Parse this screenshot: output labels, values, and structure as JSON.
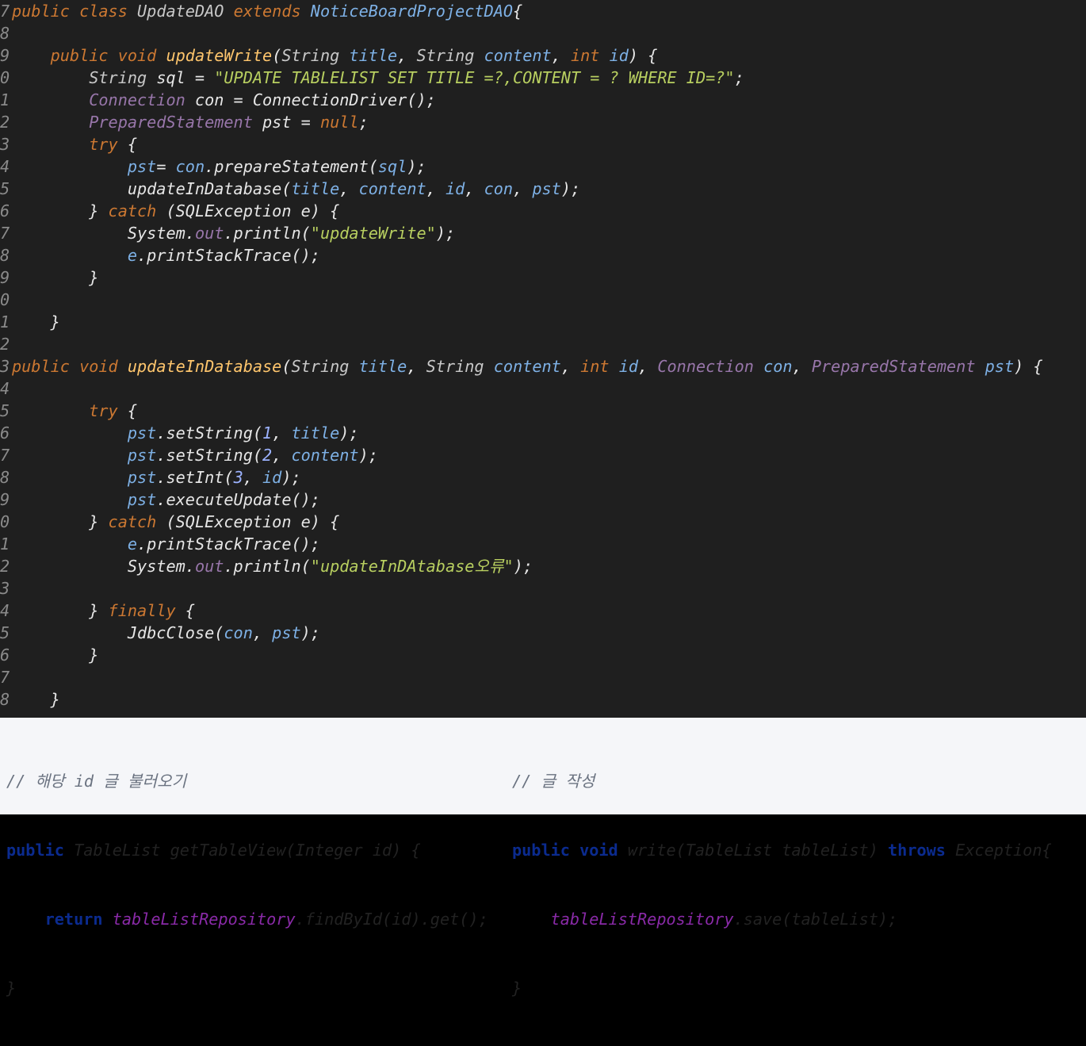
{
  "editor": {
    "lines": [
      {
        "gutter": "7",
        "tokens": [
          [
            "k",
            "public class "
          ],
          [
            "t",
            "UpdateDAO "
          ],
          [
            "k",
            "extends "
          ],
          [
            "v",
            "NoticeBoardProjectDAO"
          ],
          [
            "plain",
            "{"
          ]
        ]
      },
      {
        "gutter": "8",
        "tokens": []
      },
      {
        "gutter": "9",
        "tokens": [
          [
            "plain",
            "    "
          ],
          [
            "k",
            "public void "
          ],
          [
            "m",
            "updateWrite"
          ],
          [
            "plain",
            "("
          ],
          [
            "t",
            "String "
          ],
          [
            "v",
            "title"
          ],
          [
            "plain",
            ", "
          ],
          [
            "t",
            "String "
          ],
          [
            "v",
            "content"
          ],
          [
            "plain",
            ", "
          ],
          [
            "k",
            "int "
          ],
          [
            "v",
            "id"
          ],
          [
            "plain",
            ") {"
          ]
        ]
      },
      {
        "gutter": "0",
        "tokens": [
          [
            "plain",
            "        "
          ],
          [
            "t",
            "String "
          ],
          [
            "plain",
            "sql = "
          ],
          [
            "s",
            "\"UPDATE TABLELIST SET TITLE =?,CONTENT = ? WHERE ID=?\""
          ],
          [
            "plain",
            ";"
          ]
        ]
      },
      {
        "gutter": "1",
        "tokens": [
          [
            "plain",
            "        "
          ],
          [
            "c",
            "Connection "
          ],
          [
            "plain",
            "con = ConnectionDriver();"
          ]
        ]
      },
      {
        "gutter": "2",
        "tokens": [
          [
            "plain",
            "        "
          ],
          [
            "c",
            "PreparedStatement "
          ],
          [
            "plain",
            "pst = "
          ],
          [
            "k",
            "null"
          ],
          [
            "plain",
            ";"
          ]
        ]
      },
      {
        "gutter": "3",
        "tokens": [
          [
            "plain",
            "        "
          ],
          [
            "k",
            "try "
          ],
          [
            "plain",
            "{"
          ]
        ]
      },
      {
        "gutter": "4",
        "tokens": [
          [
            "plain",
            "            "
          ],
          [
            "v",
            "pst"
          ],
          [
            "plain",
            "= "
          ],
          [
            "v",
            "con"
          ],
          [
            "plain",
            ".prepareStatement("
          ],
          [
            "v",
            "sql"
          ],
          [
            "plain",
            ");"
          ]
        ]
      },
      {
        "gutter": "5",
        "tokens": [
          [
            "plain",
            "            updateInDatabase("
          ],
          [
            "v",
            "title"
          ],
          [
            "plain",
            ", "
          ],
          [
            "v",
            "content"
          ],
          [
            "plain",
            ", "
          ],
          [
            "v",
            "id"
          ],
          [
            "plain",
            ", "
          ],
          [
            "v",
            "con"
          ],
          [
            "plain",
            ", "
          ],
          [
            "v",
            "pst"
          ],
          [
            "plain",
            ");"
          ]
        ]
      },
      {
        "gutter": "6",
        "tokens": [
          [
            "plain",
            "        } "
          ],
          [
            "k",
            "catch "
          ],
          [
            "plain",
            "(SQLException e) {"
          ]
        ]
      },
      {
        "gutter": "7",
        "tokens": [
          [
            "plain",
            "            System."
          ],
          [
            "c",
            "out"
          ],
          [
            "plain",
            ".println("
          ],
          [
            "s",
            "\"updateWrite\""
          ],
          [
            "plain",
            ");"
          ]
        ]
      },
      {
        "gutter": "8",
        "tokens": [
          [
            "plain",
            "            "
          ],
          [
            "v",
            "e"
          ],
          [
            "plain",
            ".printStackTrace();"
          ]
        ]
      },
      {
        "gutter": "9",
        "tokens": [
          [
            "plain",
            "        }"
          ]
        ]
      },
      {
        "gutter": "0",
        "tokens": []
      },
      {
        "gutter": "1",
        "tokens": [
          [
            "plain",
            "    }"
          ]
        ]
      },
      {
        "gutter": "2",
        "tokens": []
      },
      {
        "gutter": "3",
        "tokens": [
          [
            "k",
            "public void "
          ],
          [
            "m",
            "updateInDatabase"
          ],
          [
            "plain",
            "("
          ],
          [
            "t",
            "String "
          ],
          [
            "v",
            "title"
          ],
          [
            "plain",
            ", "
          ],
          [
            "t",
            "String "
          ],
          [
            "v",
            "content"
          ],
          [
            "plain",
            ", "
          ],
          [
            "k",
            "int "
          ],
          [
            "v",
            "id"
          ],
          [
            "plain",
            ", "
          ],
          [
            "c",
            "Connection "
          ],
          [
            "v",
            "con"
          ],
          [
            "plain",
            ", "
          ],
          [
            "c",
            "PreparedStatement "
          ],
          [
            "v",
            "pst"
          ],
          [
            "plain",
            ") {"
          ]
        ]
      },
      {
        "gutter": "4",
        "tokens": []
      },
      {
        "gutter": "5",
        "tokens": [
          [
            "plain",
            "        "
          ],
          [
            "k",
            "try "
          ],
          [
            "plain",
            "{"
          ]
        ]
      },
      {
        "gutter": "6",
        "tokens": [
          [
            "plain",
            "            "
          ],
          [
            "v",
            "pst"
          ],
          [
            "plain",
            ".setString("
          ],
          [
            "n",
            "1"
          ],
          [
            "plain",
            ", "
          ],
          [
            "v",
            "title"
          ],
          [
            "plain",
            ");"
          ]
        ]
      },
      {
        "gutter": "7",
        "tokens": [
          [
            "plain",
            "            "
          ],
          [
            "v",
            "pst"
          ],
          [
            "plain",
            ".setString("
          ],
          [
            "n",
            "2"
          ],
          [
            "plain",
            ", "
          ],
          [
            "v",
            "content"
          ],
          [
            "plain",
            ");"
          ]
        ]
      },
      {
        "gutter": "8",
        "tokens": [
          [
            "plain",
            "            "
          ],
          [
            "v",
            "pst"
          ],
          [
            "plain",
            ".setInt("
          ],
          [
            "n",
            "3"
          ],
          [
            "plain",
            ", "
          ],
          [
            "v",
            "id"
          ],
          [
            "plain",
            ");"
          ]
        ]
      },
      {
        "gutter": "9",
        "tokens": [
          [
            "plain",
            "            "
          ],
          [
            "v",
            "pst"
          ],
          [
            "plain",
            ".executeUpdate();"
          ]
        ]
      },
      {
        "gutter": "0",
        "tokens": [
          [
            "plain",
            "        } "
          ],
          [
            "k",
            "catch "
          ],
          [
            "plain",
            "(SQLException e) {"
          ]
        ]
      },
      {
        "gutter": "1",
        "tokens": [
          [
            "plain",
            "            "
          ],
          [
            "v",
            "e"
          ],
          [
            "plain",
            ".printStackTrace();"
          ]
        ]
      },
      {
        "gutter": "2",
        "tokens": [
          [
            "plain",
            "            System."
          ],
          [
            "c",
            "out"
          ],
          [
            "plain",
            ".println("
          ],
          [
            "s",
            "\"updateInDAtabase오류\""
          ],
          [
            "plain",
            ");"
          ]
        ]
      },
      {
        "gutter": "3",
        "tokens": []
      },
      {
        "gutter": "4",
        "tokens": [
          [
            "plain",
            "        } "
          ],
          [
            "k",
            "finally "
          ],
          [
            "plain",
            "{"
          ]
        ]
      },
      {
        "gutter": "5",
        "tokens": [
          [
            "plain",
            "            JdbcClose("
          ],
          [
            "v",
            "con"
          ],
          [
            "plain",
            ", "
          ],
          [
            "v",
            "pst"
          ],
          [
            "plain",
            ");"
          ]
        ]
      },
      {
        "gutter": "6",
        "tokens": [
          [
            "plain",
            "        }"
          ]
        ]
      },
      {
        "gutter": "7",
        "tokens": []
      },
      {
        "gutter": "8",
        "tokens": [
          [
            "plain",
            "    }"
          ]
        ]
      }
    ]
  },
  "snippet_left": {
    "comment": "// 해당 id 글 불러오기",
    "kw_public": "public",
    "sig": " TableList getTableView(Integer id) {",
    "kw_return": "return",
    "field": "tableListRepository",
    "call": ".findById(id).get();",
    "close": "}"
  },
  "snippet_right": {
    "comment": "// 글 작성",
    "kw_public_void": "public void",
    "sig": " write(TableList tableList) ",
    "kw_throws": "throws",
    "sig_end": " Exception{",
    "field": "tableListRepository",
    "call": ".save(tableList);",
    "close": "}"
  }
}
